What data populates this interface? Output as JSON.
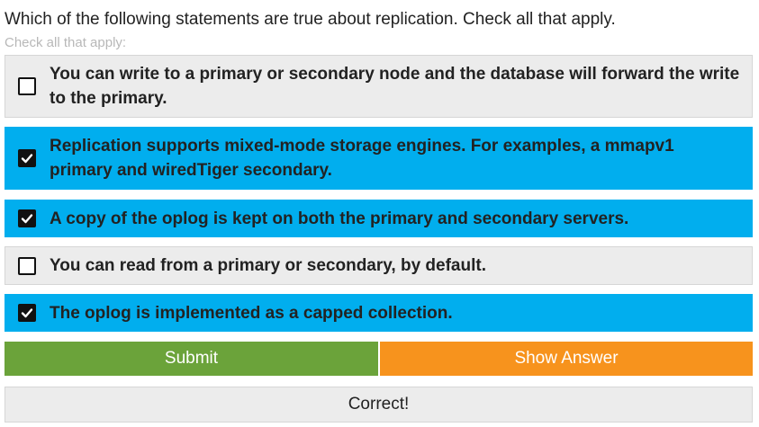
{
  "question": {
    "text": "Which of the following statements are true about replication. Check all that apply.",
    "hint": "Check all that apply:"
  },
  "options": [
    {
      "label": "You can write to a primary or secondary node and the database will forward the write to the primary.",
      "checked": false
    },
    {
      "label": "Replication supports mixed-mode storage engines. For examples, a mmapv1 primary and wiredTiger secondary.",
      "checked": true
    },
    {
      "label": "A copy of the oplog is kept on both the primary and secondary servers.",
      "checked": true
    },
    {
      "label": "You can read from a primary or secondary, by default.",
      "checked": false
    },
    {
      "label": "The oplog is implemented as a capped collection.",
      "checked": true
    }
  ],
  "buttons": {
    "submit_label": "Submit",
    "show_answer_label": "Show Answer"
  },
  "result": {
    "text": "Correct!"
  },
  "colors": {
    "checked_bg": "#01aeee",
    "unchecked_bg": "#ececec",
    "submit_bg": "#6ba33a",
    "show_answer_bg": "#f7931d"
  },
  "icons": {
    "checked": "checkmark-icon",
    "unchecked": "empty-checkbox-icon"
  }
}
